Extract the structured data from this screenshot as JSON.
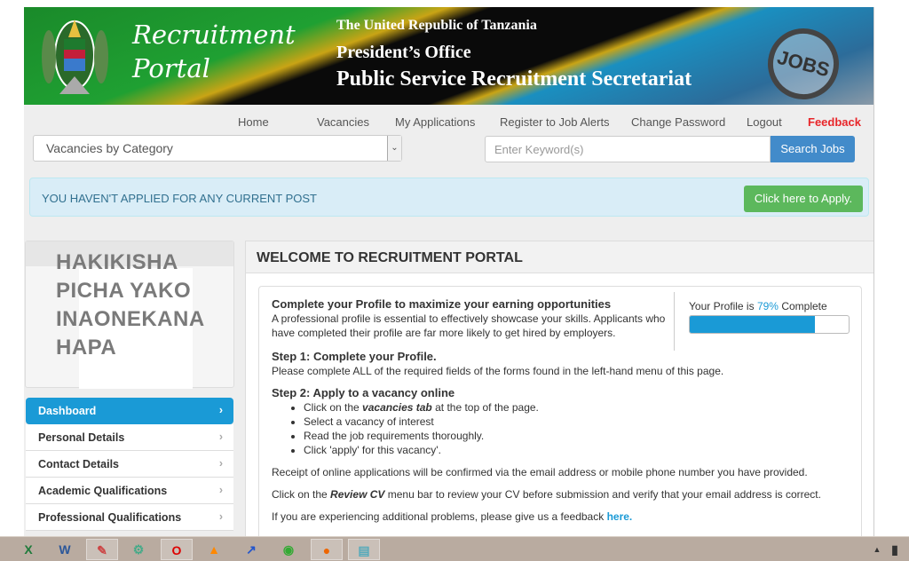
{
  "banner": {
    "brand_line1": "Recruitment",
    "brand_line2": "Portal",
    "line1": "The United Republic of Tanzania",
    "line2": "President’s Office",
    "line3": "Public Service Recruitment Secretariat",
    "jobs_image_text": "JOBS"
  },
  "nav": {
    "items": [
      "Home",
      "Vacancies",
      "My Applications",
      "Register to Job Alerts",
      "Change Password",
      "Logout"
    ],
    "feedback": "Feedback"
  },
  "search": {
    "category_select": "Vacancies by Category",
    "keyword_placeholder": "Enter Keyword(s)",
    "button": "Search Jobs"
  },
  "alert": {
    "text": "YOU HAVEN'T APPLIED FOR ANY CURRENT POST",
    "button": "Click here to Apply."
  },
  "photo": {
    "lines": [
      "HAKIKISHA",
      "PICHA YAKO",
      "INAONEKANA",
      "HAPA"
    ]
  },
  "sidebar": {
    "items": [
      "Dashboard",
      "Personal Details",
      "Contact Details",
      "Academic Qualifications",
      "Professional Qualifications"
    ],
    "active": "Dashboard"
  },
  "main": {
    "title": "WELCOME TO RECRUITMENT PORTAL",
    "intro_title": "Complete your Profile to maximize your earning opportunities",
    "intro_text": "A professional profile is essential to effectively showcase your skills. Applicants who have completed their profile are far more likely to get hired by employers.",
    "profile": {
      "prefix": "Your Profile is",
      "percent_text": "79%",
      "suffix": "Complete",
      "percent": 79
    },
    "step1_title": "Step 1: Complete your Profile.",
    "step1_text": "Please complete ALL of the required fields of the forms found in the left-hand menu of this page.",
    "step2_title": "Step 2: Apply to a vacancy online",
    "step2_b1_pre": "Click on the",
    "step2_b1_em": "vacancies tab",
    "step2_b1_post": "at the top of the page.",
    "step2_b2": "Select a vacancy of interest",
    "step2_b3": "Read the job requirements thoroughly.",
    "step2_b4": "Click 'apply' for this vacancy'.",
    "receipt": "Receipt of online applications will be confirmed via the email address or mobile phone number you have provided.",
    "review_pre": "Click on the",
    "review_em": "Review CV",
    "review_post": "menu bar to review your CV before submission and verify that your email address is correct.",
    "problems": "If you are experiencing additional problems, please give us a feedback",
    "here_link": "here."
  },
  "colors": {
    "accent": "#1a9ad6",
    "feedback": "#e8262a",
    "success": "#5cb85c",
    "search_button": "#428bca"
  },
  "taskbar": {
    "icons": [
      "excel-icon",
      "word-icon",
      "paint-icon",
      "tool-icon",
      "opera-icon",
      "vlc-icon",
      "shortcut-icon",
      "chrome-icon",
      "firefox-icon",
      "notepad-icon"
    ]
  }
}
